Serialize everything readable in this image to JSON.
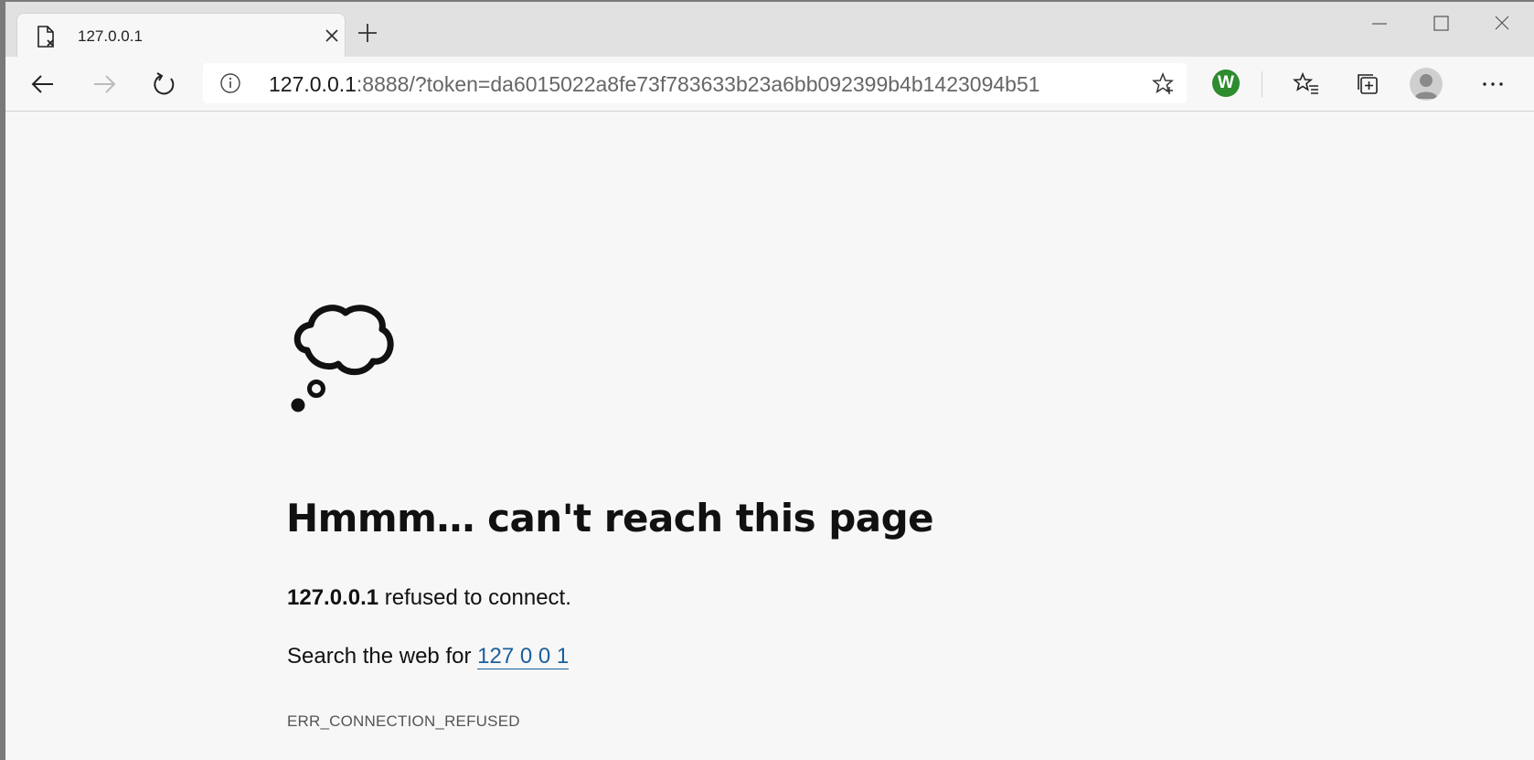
{
  "tab": {
    "title": "127.0.0.1"
  },
  "address_bar": {
    "host": "127.0.0.1",
    "rest": ":8888/?token=da6015022a8fe73f783633b23a6bb092399b4b1423094b51"
  },
  "extension": {
    "letter": "W",
    "color": "#2e8b2e"
  },
  "error": {
    "heading": "Hmmm… can't reach this page",
    "host": "127.0.0.1",
    "message": "refused to connect.",
    "search_prefix": "Search the web for",
    "search_link": "127 0 0 1",
    "code": "ERR_CONNECTION_REFUSED"
  },
  "icons": [
    "page-error-icon",
    "close-icon",
    "plus-icon",
    "minimize-icon",
    "maximize-icon",
    "window-close-icon",
    "back-arrow-icon",
    "forward-arrow-icon",
    "refresh-icon",
    "info-icon",
    "star-icon",
    "favorites-icon",
    "collections-icon",
    "profile-icon",
    "more-icon",
    "thought-cloud-icon"
  ]
}
